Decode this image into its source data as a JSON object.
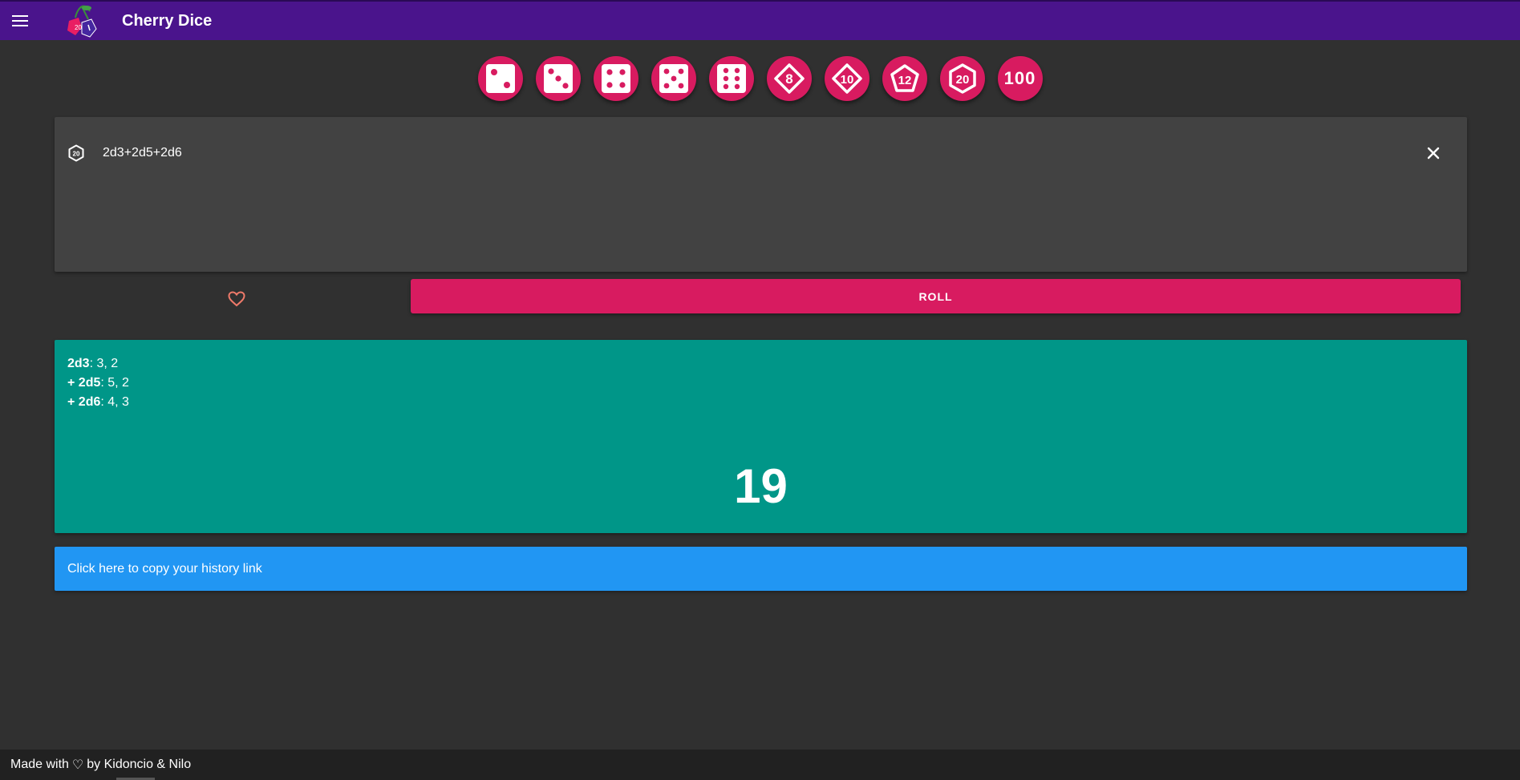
{
  "app": {
    "title": "Cherry Dice",
    "logo_text": "20"
  },
  "dice": [
    {
      "name": "d3",
      "icon": "die-face-2-icon"
    },
    {
      "name": "d4",
      "icon": "die-face-3-icon"
    },
    {
      "name": "d5",
      "icon": "die-face-4-icon"
    },
    {
      "name": "d6",
      "icon": "die-face-5-icon"
    },
    {
      "name": "d7",
      "icon": "die-face-6-icon"
    },
    {
      "name": "d8",
      "icon": "d8-icon",
      "label": "8"
    },
    {
      "name": "d10",
      "icon": "d10-icon",
      "label": "10"
    },
    {
      "name": "d12",
      "icon": "d12-icon",
      "label": "12"
    },
    {
      "name": "d20",
      "icon": "d20-icon",
      "label": "20"
    },
    {
      "name": "d100",
      "icon": "percentile-icon",
      "label": "100"
    }
  ],
  "input": {
    "value": "2d3+2d5+2d6",
    "icon_label": "20"
  },
  "roll_button": "ROLL",
  "result": {
    "lines": [
      {
        "prefix": "",
        "dice": "2d3",
        "rolls": ": 3, 2"
      },
      {
        "prefix": "+ ",
        "dice": "2d5",
        "rolls": ": 5, 2"
      },
      {
        "prefix": "+ ",
        "dice": "2d6",
        "rolls": ": 4, 3"
      }
    ],
    "total": "19"
  },
  "history_link": "Click here to copy your history link",
  "footer": {
    "prefix": "Made with",
    "heart": "♡",
    "suffix": "by Kidoncio & Nilo"
  },
  "colors": {
    "appbar": "#4a148c",
    "accent": "#d81b60",
    "result": "#009688",
    "history": "#2196f3",
    "background": "#303030"
  }
}
